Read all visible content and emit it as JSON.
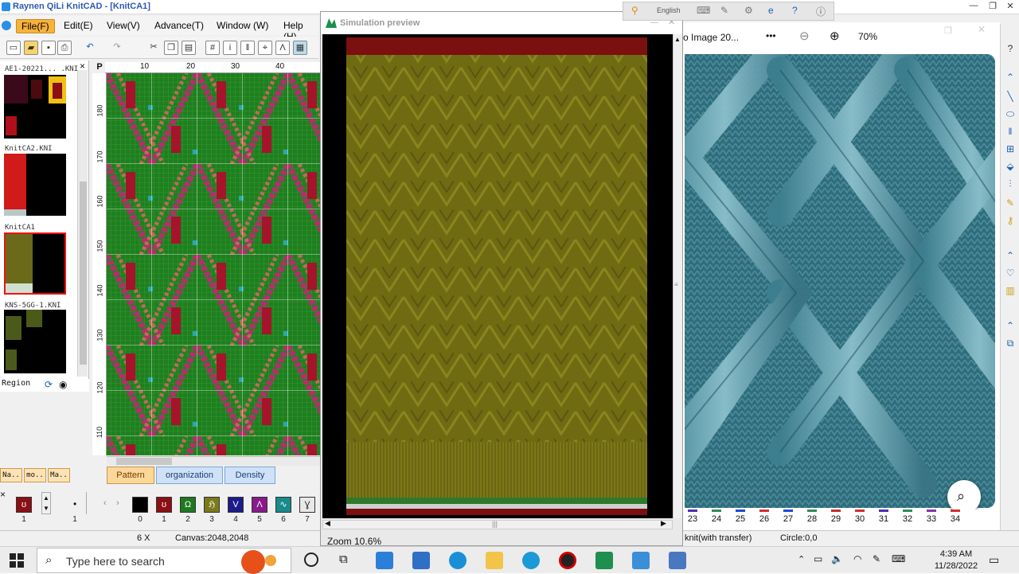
{
  "app": {
    "title": "Raynen QiLi KnitCAD - [KnitCA1]",
    "menus": [
      "File(F)",
      "Edit(E)",
      "View(V)",
      "Advance(T)",
      "Window (W)",
      "Help (H)"
    ]
  },
  "files": [
    {
      "name": "AE1-20221... .KNI"
    },
    {
      "name": "KnitCA2.KNI"
    },
    {
      "name": "KnitCA1"
    },
    {
      "name": "KNS-5GG-1.KNI"
    }
  ],
  "region_label": "Region",
  "small_tabs": [
    "Na..",
    "mo..",
    "Ma.."
  ],
  "ruler": {
    "top_ticks": [
      "P",
      "10",
      "20",
      "30",
      "40"
    ],
    "left_ticks": [
      "180",
      "170",
      "160",
      "150",
      "140",
      "130",
      "120",
      "110"
    ]
  },
  "pattern_tabs": [
    "Pattern",
    "organization",
    "Density"
  ],
  "palette": {
    "current": "1",
    "current2": "1",
    "colors": [
      {
        "num": "0",
        "color": "#000000",
        "glyph": ""
      },
      {
        "num": "1",
        "color": "#8b0f14",
        "glyph": "ʊ"
      },
      {
        "num": "2",
        "color": "#1f7a1f",
        "glyph": "Ω"
      },
      {
        "num": "3",
        "color": "#7a7a1a",
        "glyph": "ℌ"
      },
      {
        "num": "4",
        "color": "#1b1b8a",
        "glyph": "V"
      },
      {
        "num": "5",
        "color": "#8a1a8a",
        "glyph": "Λ"
      },
      {
        "num": "6",
        "color": "#1a8a8a",
        "glyph": "∿"
      },
      {
        "num": "7",
        "color": "#e8e8e8",
        "glyph": "Ɣ"
      }
    ]
  },
  "status": {
    "mode": "6 X",
    "canvas": "Canvas:2048,2048",
    "transfer": "knit(with transfer)",
    "circle": "Circle:0,0"
  },
  "sim": {
    "title": "Simulation preview",
    "zoom": "Zoom 10.6%"
  },
  "viewer": {
    "title": "o Image 20...",
    "more": "•••",
    "zoom": "70%"
  },
  "langbar": {
    "language": "English"
  },
  "axis": [
    "23",
    "24",
    "25",
    "26",
    "27",
    "28",
    "29",
    "30",
    "31",
    "32",
    "33",
    "34"
  ],
  "axis_colors": [
    "#4c2fb0",
    "#2e8b57",
    "#1e4bd0",
    "#d03030",
    "#1e4bd0",
    "#2e8b57",
    "#c03030",
    "#d03030",
    "#4c2fb0",
    "#2e8b57",
    "#8a30b0",
    "#d03030"
  ],
  "taskbar": {
    "search_placeholder": "Type here to search",
    "time": "4:39 AM",
    "date": "11/28/2022"
  }
}
